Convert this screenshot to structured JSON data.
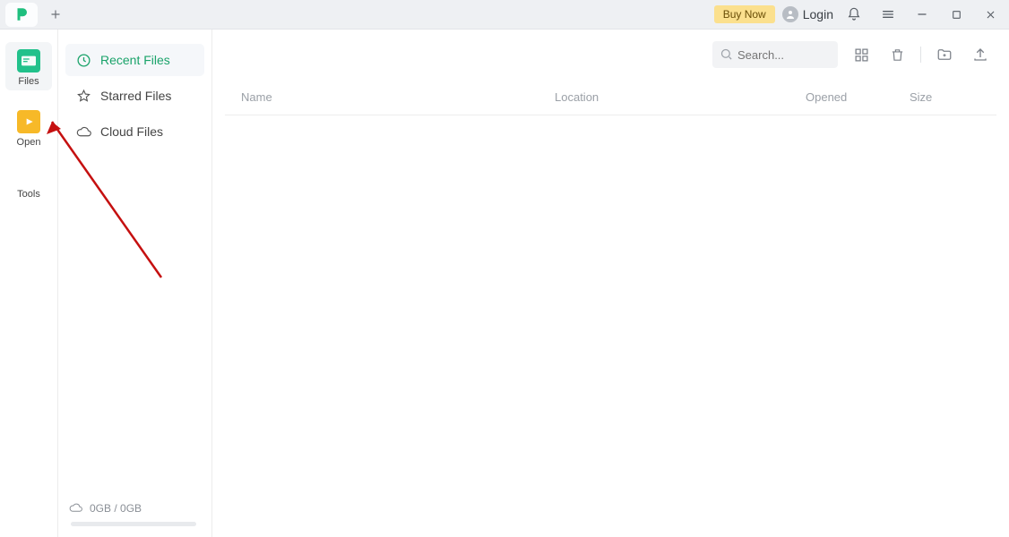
{
  "titlebar": {
    "buy_now": "Buy Now",
    "login": "Login"
  },
  "rail": {
    "files": "Files",
    "open": "Open",
    "tools": "Tools"
  },
  "side": {
    "items": [
      {
        "label": "Recent Files"
      },
      {
        "label": "Starred Files"
      },
      {
        "label": "Cloud Files"
      }
    ],
    "storage": "0GB / 0GB"
  },
  "toolbar": {
    "search_placeholder": "Search..."
  },
  "columns": {
    "name": "Name",
    "location": "Location",
    "opened": "Opened",
    "size": "Size"
  }
}
